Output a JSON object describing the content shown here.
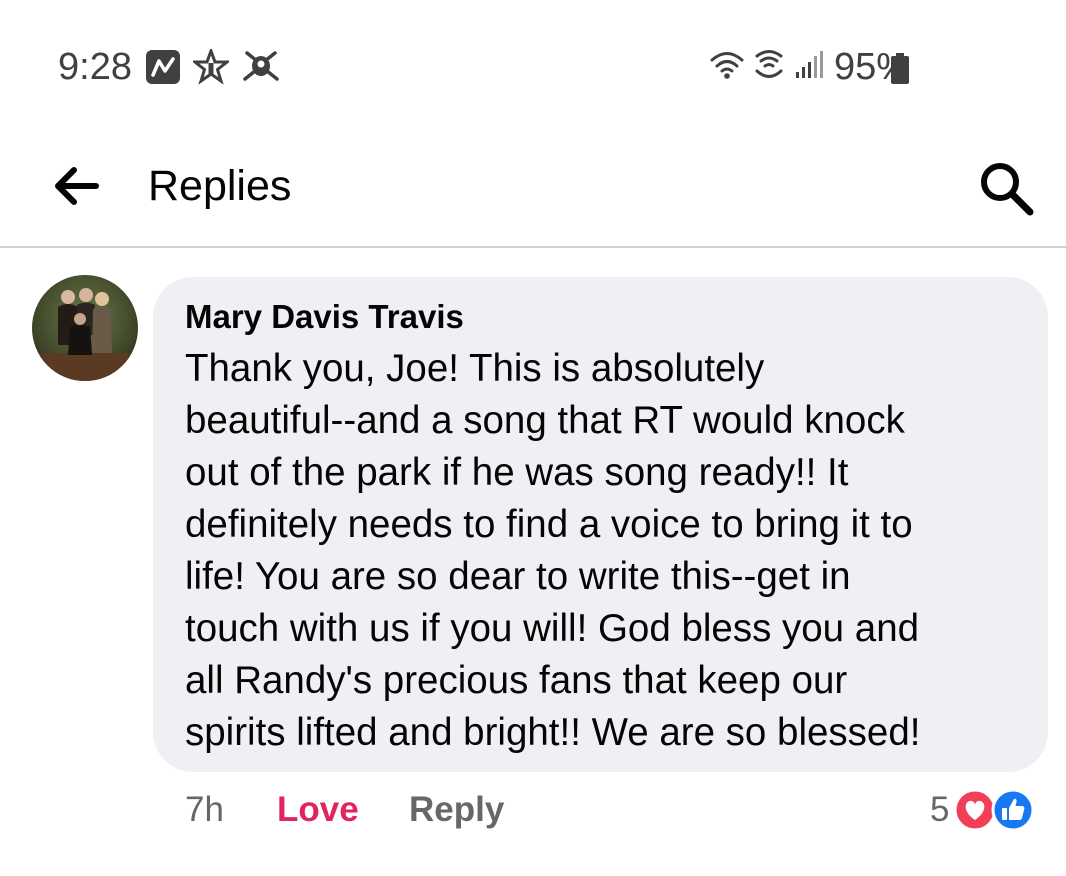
{
  "status_bar": {
    "time": "9:28",
    "battery": "95%",
    "icons_left": [
      "news-app-icon",
      "star-icon",
      "bug-icon"
    ],
    "icons_right": [
      "wifi-icon",
      "wifi-calling-icon",
      "signal-icon",
      "battery-icon"
    ]
  },
  "header": {
    "title": "Replies",
    "back_icon": "arrow-left-icon",
    "search_icon": "search-icon"
  },
  "comment": {
    "author": "Mary Davis Travis",
    "lines": [
      "Thank you, Joe!  This is absolutely",
      "beautiful--and a song that RT would knock",
      "out of the park if he was song ready!! It",
      "definitely needs to find a voice to bring it to",
      "life!  You are so dear to write this--get in",
      "touch with us if you will!  God bless you and",
      "all Randy's precious fans that keep our",
      "spirits lifted and bright!!  We are so blessed!"
    ],
    "time": "7h",
    "love_label": "Love",
    "reply_label": "Reply",
    "reaction_count": "5",
    "reaction_icons": [
      "love-reaction-icon",
      "like-reaction-icon"
    ]
  },
  "colors": {
    "love": "#e0245e",
    "like": "#1877f2",
    "bubble": "#eef0f3",
    "meta": "#65676b"
  }
}
